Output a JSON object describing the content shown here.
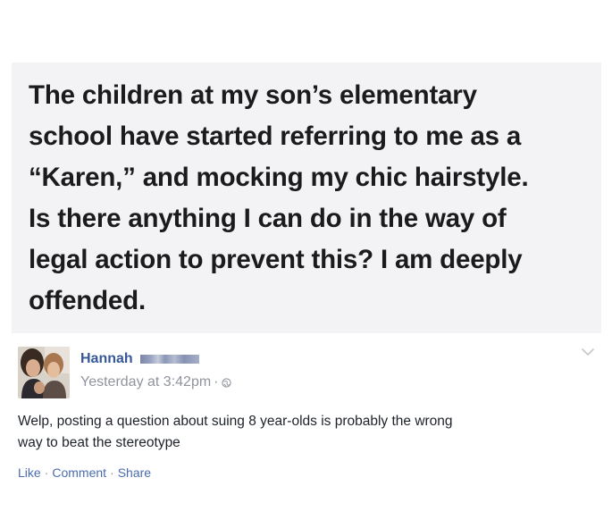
{
  "post": {
    "lines": [
      "The children at my son’s elementary",
      "school have started referring to me as a",
      "“Karen,” and mocking my chic hairstyle.",
      "Is there anything I can do in the way of",
      "legal action to prevent this? I am deeply",
      "offended."
    ]
  },
  "comment": {
    "author": "Hannah",
    "timestamp": "Yesterday at 3:42pm",
    "separator": "·",
    "text_lines": [
      "Welp, posting a question about suing 8 year-olds is probably the wrong",
      "way to beat the stereotype"
    ],
    "actions": {
      "like": "Like",
      "comment": "Comment",
      "share": "Share",
      "separator": "·"
    }
  },
  "icons": {
    "privacy": "globe-icon",
    "menu": "chevron-down-icon",
    "avatar": "profile-photo"
  },
  "colors": {
    "post_background": "#f3f3f5",
    "post_text": "#1b1b1d",
    "author_link": "#365899",
    "meta_gray": "#90949c",
    "action_link": "#4b6cb0"
  }
}
